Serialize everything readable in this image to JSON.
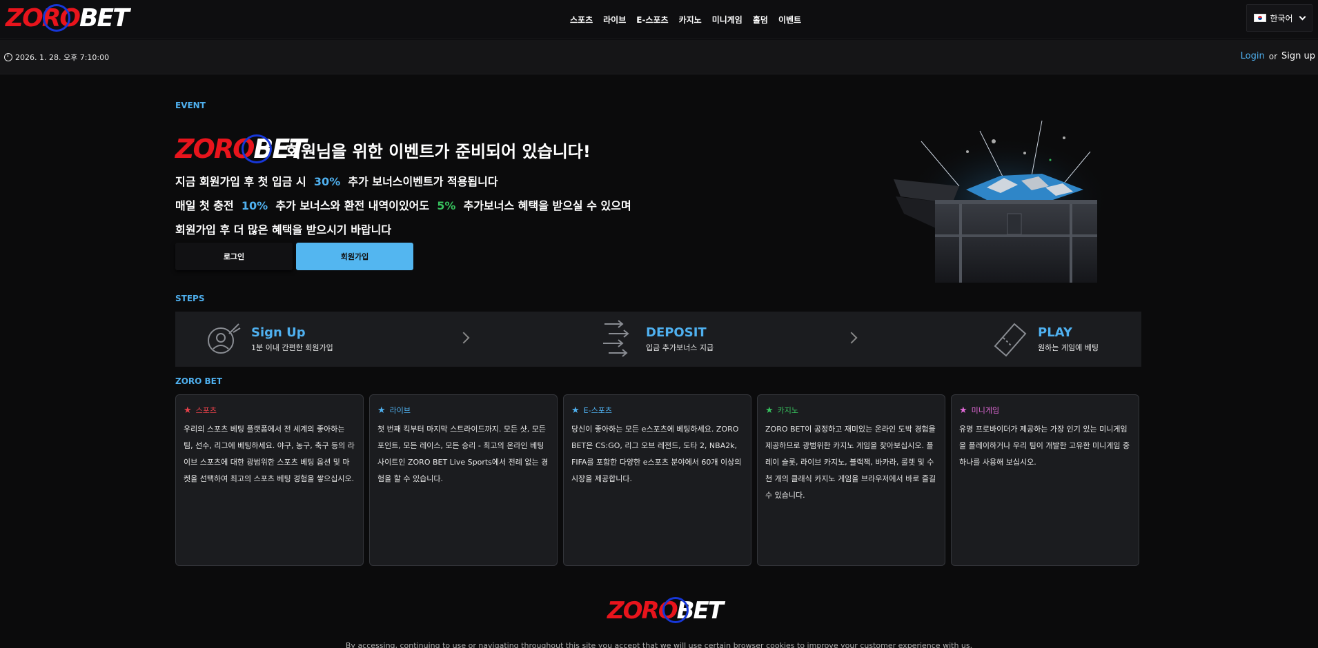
{
  "brand": {
    "logo_part1": "ZORO",
    "logo_part2": "BET"
  },
  "nav": [
    "스포츠",
    "라이브",
    "E-스포츠",
    "카지노",
    "미니게임",
    "홀덤",
    "이벤트"
  ],
  "language": {
    "label": "한국어",
    "icon": "korea-flag-icon"
  },
  "datetime": "2026. 1. 28. 오후 7:10:00",
  "auth": {
    "login": "Login",
    "or": "or",
    "signup": "Sign up"
  },
  "event": {
    "section_label": "EVENT",
    "title": "회원님을 위한 이벤트가 준비되어 있습니다!",
    "line1": {
      "a": "지금 회원가입 후 첫 입금 시",
      "pct": "30%",
      "b": "추가 보너스이벤트가 적용됩니다"
    },
    "line2": {
      "a": "매일 첫 충전",
      "pct1": "10%",
      "b": "추가 보너스와 환전 내역이있어도",
      "pct2": "5%",
      "c": "추가보너스 혜택을 받으실 수 있으며"
    },
    "line3": "회원가입 후 더 많은 혜택을 받으시기 바랍니다",
    "login_button": "로그인",
    "join_button": "회원가입"
  },
  "steps": {
    "section_label": "STEPS",
    "items": [
      {
        "title": "Sign Up",
        "sub": "1분 이내 간편한 회원가입",
        "icon": "user-signup-icon"
      },
      {
        "title": "DEPOSIT",
        "sub": "입금 추가보너스 지급",
        "icon": "deposit-arrows-icon"
      },
      {
        "title": "PLAY",
        "sub": "원하는 게임에 베팅",
        "icon": "ticket-icon"
      }
    ]
  },
  "features": {
    "section_label": "ZORO BET",
    "cards": [
      {
        "title": "스포츠",
        "color": "#e8414a",
        "text": "우리의 스포츠 베팅 플랫폼에서 전 세계의 좋아하는 팀, 선수, 리그에 베팅하세요. 야구, 농구, 축구 등의 라이브 스포츠에 대한 광범위한 스포츠 베팅 옵션 및 마켓을 선택하여 최고의 스포츠 베팅 경험을 쌓으십시오."
      },
      {
        "title": "라이브",
        "color": "#4fb0ef",
        "text": "첫 번째 킥부터 마지막 스트라이드까지. 모든 샷, 모든 포인트, 모든 레이스, 모든 승리 - 최고의 온라인 베팅 사이트인 ZORO BET Live Sports에서 전례 없는 경험을 할 수 있습니다."
      },
      {
        "title": "E-스포츠",
        "color": "#4fb0ef",
        "text": "당신이 좋아하는 모든 e스포츠에 베팅하세요. ZORO BET은 CS:GO, 리그 오브 레전드, 도타 2, NBA2k, FIFA를 포함한 다양한 e스포츠 분야에서 60개 이상의 시장을 제공합니다."
      },
      {
        "title": "카지노",
        "color": "#37c25e",
        "text": "ZORO BET이 공정하고 재미있는 온라인 도박 경험을 제공하므로 광범위한 카지노 게임을 찾아보십시오. 플레이 슬롯, 라이브 카지노, 블랙잭, 바카라, 룰렛 및 수천 개의 클래식 카지노 게임을 브라우저에서 바로 즐길 수 있습니다."
      },
      {
        "title": "미니게임",
        "color": "#e36ad9",
        "text": "유명 프로바이더가 제공하는 가장 인기 있는 미니게임을 플레이하거나 우리 팀이 개발한 고유한 미니게임 중 하나를 사용해 보십시오."
      }
    ]
  },
  "cookie_notice": "By accessing, continuing to use or navigating throughout this site you accept that we will use certain browser cookies to improve your customer experience with us."
}
